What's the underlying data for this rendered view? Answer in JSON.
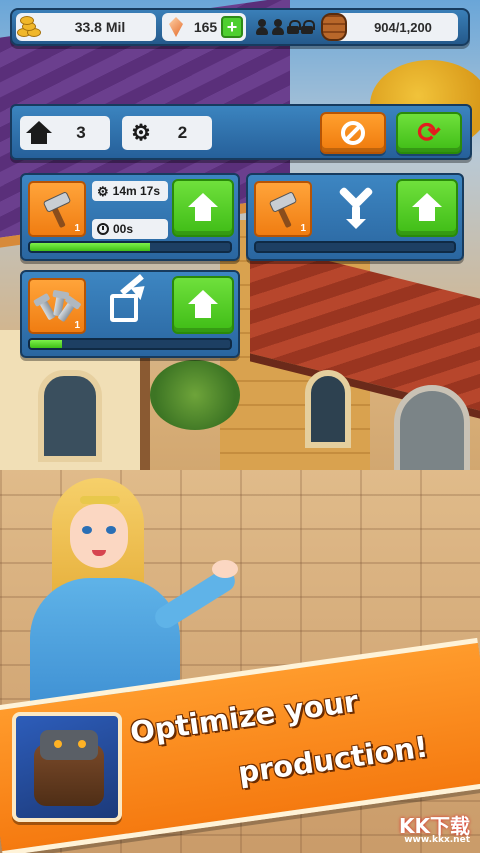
{
  "topbar": {
    "gold": "33.8 Mil",
    "gems": "165",
    "plus": "+",
    "storage": "904/1,200"
  },
  "building": {
    "houses": "3",
    "gears": "2"
  },
  "panels": [
    {
      "tool": "hammer",
      "level": "1",
      "time_remaining": "14m 17s",
      "cycle_time": "00s",
      "progress": 0.6
    },
    {
      "tool": "hammer",
      "level": "1",
      "progress": 0.0
    },
    {
      "tool": "bolts",
      "level": "1",
      "progress": 0.16
    }
  ],
  "banner": {
    "line1": "Optimize your",
    "line2": "production!"
  },
  "watermark": {
    "main": "KK下载",
    "sub": "www.kkx.net"
  },
  "colors": {
    "panel_blue": "#2a66a0",
    "button_orange": "#f07d12",
    "button_green": "#3fbc16",
    "progress_green": "#3fbf16",
    "banner_orange": "#f57a10"
  }
}
